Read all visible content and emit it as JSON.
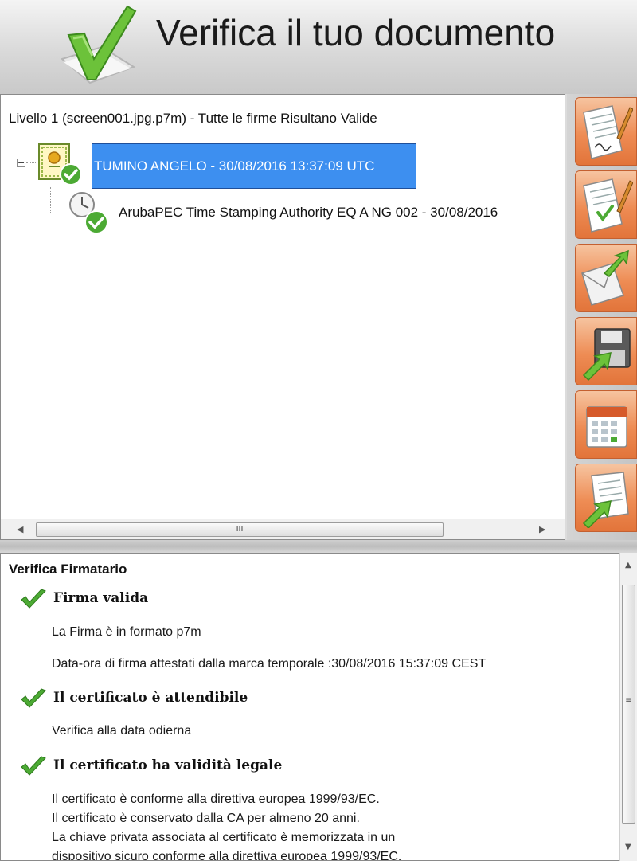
{
  "header": {
    "title": "Verifica il tuo documento",
    "logo_icon": "green-checkmark-document-icon"
  },
  "tree": {
    "header_text": "Livello 1 (screen001.jpg.p7m) - Tutte le firme Risultano Valide",
    "expander_symbol": "−",
    "signer": {
      "label": "TUMINO ANGELO - 30/08/2016 13:37:09 UTC",
      "icon": "certificate-check-icon",
      "selected": true
    },
    "timestamp": {
      "label": "ArubaPEC Time Stamping Authority EQ A NG 002 - 30/08/2016",
      "icon": "clock-check-icon"
    },
    "hscroll": {
      "left_arrow": "◀",
      "right_arrow": "▶",
      "grip": "III"
    }
  },
  "toolbar": {
    "buttons": [
      {
        "name": "sign-document",
        "icon": "document-pen-icon"
      },
      {
        "name": "verify-signature",
        "icon": "document-check-pen-icon"
      },
      {
        "name": "send-email",
        "icon": "envelope-arrow-icon"
      },
      {
        "name": "save-document",
        "icon": "floppy-arrow-icon"
      },
      {
        "name": "calendar",
        "icon": "calendar-icon"
      },
      {
        "name": "export-document",
        "icon": "document-arrow-icon"
      }
    ],
    "accent_color": "#ee8c54"
  },
  "details": {
    "title": "Verifica Firmatario",
    "check_color": "#4caa34",
    "sections": [
      {
        "heading": "Firma valida",
        "lines": [
          "La Firma è in formato p7m",
          "Data-ora di firma attestati dalla marca temporale :30/08/2016 15:37:09 CEST"
        ]
      },
      {
        "heading": "Il certificato è attendibile",
        "lines": [
          "Verifica alla data odierna"
        ]
      },
      {
        "heading": "Il certificato ha validità legale",
        "lines": [
          "Il certificato è conforme alla direttiva europea 1999/93/EC.",
          "Il certificato è conservato dalla CA per almeno 20 anni.",
          "La chiave privata associata al certificato è memorizzata in un",
          "dispositivo sicuro conforme alla direttiva europea 1999/93/EC."
        ]
      }
    ],
    "vscroll": {
      "up_arrow": "▲",
      "down_arrow": "▼",
      "grip": "≡"
    }
  }
}
